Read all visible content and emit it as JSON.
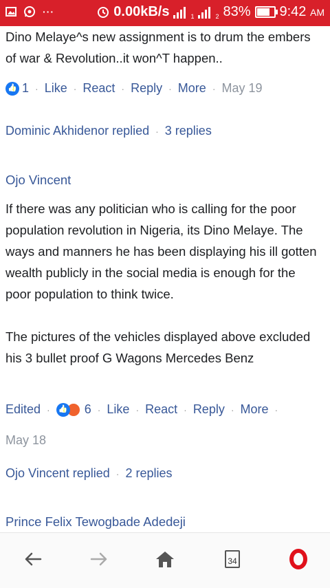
{
  "status_bar": {
    "speed": "0.00kB/s",
    "battery_pct": "83%",
    "time": "9:42",
    "ampm": "AM",
    "more": "···",
    "sim1": "1",
    "sim2": "2",
    "battery_level": 0.83
  },
  "comments": {
    "first": {
      "text": "Dino Melaye^s new assignment is to drum the embers of war & Revolution..it won^T happen..",
      "reaction_count": "1",
      "actions": {
        "like": "Like",
        "react": "React",
        "reply": "Reply",
        "more": "More"
      },
      "date": "May 19",
      "replies_link": "Dominic Akhidenor replied",
      "replies_count": "3 replies"
    },
    "second": {
      "author": "Ojo Vincent",
      "text": "If there was any politician who is calling for the poor population revolution in Nigeria, its Dino Melaye. The ways and manners he has been displaying his ill gotten wealth publicly in the social media is enough for the poor population to think twice.",
      "text2": "The pictures of the vehicles displayed above excluded his 3 bullet proof G Wagons Mercedes Benz",
      "edited": "Edited",
      "reaction_count": "6",
      "actions": {
        "like": "Like",
        "react": "React",
        "reply": "Reply",
        "more": "More"
      },
      "date": "May 18",
      "replies_link": "Ojo Vincent replied",
      "replies_count": "2 replies"
    },
    "third": {
      "author": "Prince Felix Tewogbade Adedeji"
    }
  },
  "bottom_nav": {
    "tab_count": "34"
  },
  "colors": {
    "status_bar": "#d8202a",
    "link": "#385898",
    "opera": "#e0111b"
  }
}
